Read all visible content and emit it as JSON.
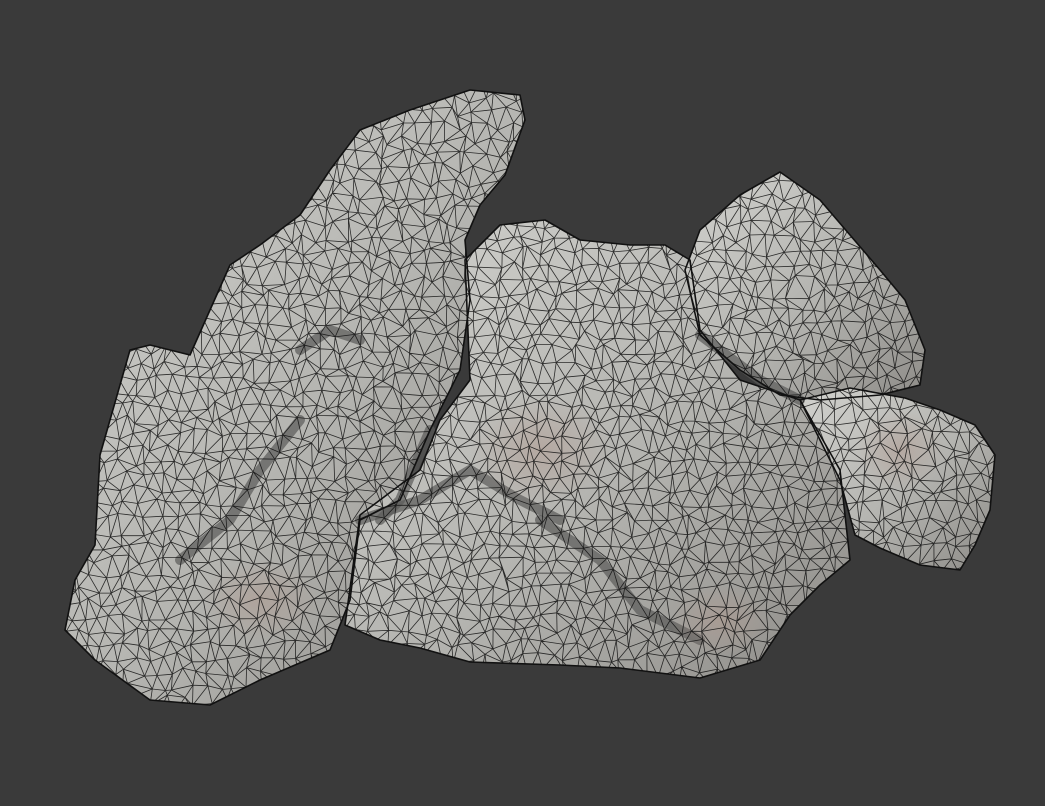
{
  "viewport": {
    "background_color": "#3a3a3a",
    "render_mode": "wireframe-on-shaded",
    "subject": "rock-mesh"
  },
  "mesh": {
    "surface_color": "#b8b8b4",
    "wire_color": "#111111",
    "shadow_color": "#5a5a58",
    "tint_color": "#b09a90"
  }
}
